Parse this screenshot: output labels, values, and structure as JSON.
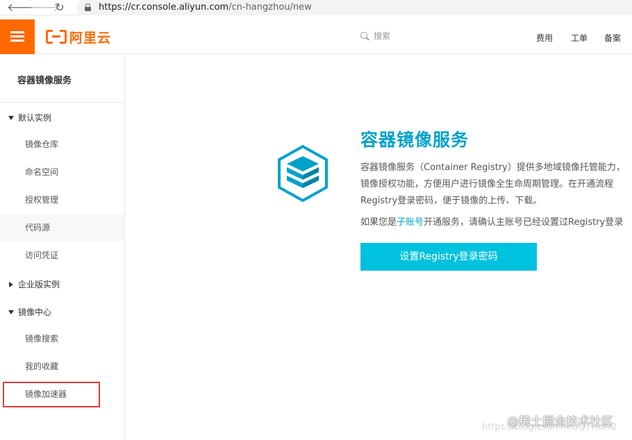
{
  "browser": {
    "url_host": "https://cr.console.aliyun.com",
    "url_path": "/cn-hangzhou/new",
    "back_glyph": "🡐",
    "forward_glyph": "🡒",
    "reload_glyph": "↻"
  },
  "header": {
    "logo_text": "阿里云",
    "search_placeholder": "搜索",
    "links": [
      "费用",
      "工单",
      "备案"
    ]
  },
  "sidebar": {
    "title": "容器镜像服务",
    "groups": [
      {
        "label": "默认实例",
        "expanded": true,
        "items": [
          "镜像仓库",
          "命名空间",
          "授权管理",
          "代码源",
          "访问凭证"
        ]
      },
      {
        "label": "企业版实例",
        "expanded": false,
        "items": []
      },
      {
        "label": "镜像中心",
        "expanded": true,
        "items": [
          "镜像搜索",
          "我的收藏",
          "镜像加速器"
        ]
      }
    ]
  },
  "main": {
    "title": "容器镜像服务",
    "description_lines": [
      "容器镜像服务（Container Registry）提供多地域镜像托管能力，",
      "镜像授权功能，方便用户进行镜像全生命周期管理。在开通流程",
      "Registry登录密码，便于镜像的上传、下载。"
    ],
    "note_prefix": "如果您是",
    "note_link": "子账号",
    "note_suffix": "开通服务，请确认主账号已经设置过Registry登录",
    "primary_button": "设置Registry登录密码"
  },
  "watermark": {
    "text": "@稀土掘金技术社区",
    "url": "https://blog.csdn.net/QTHuhQ"
  },
  "colors": {
    "brand": "#ff6a00",
    "accent": "#00a2ca",
    "button": "#00c1de",
    "highlight": "#e0393e"
  }
}
